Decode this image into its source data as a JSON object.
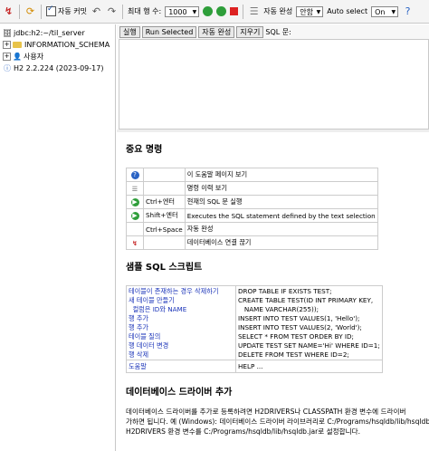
{
  "toolbar": {
    "auto_commit_label": "자동 커밋",
    "max_rows_label": "최대 행 수:",
    "max_rows_value": "1000",
    "auto_complete_label": "자동 완성",
    "auto_complete_value": "안함",
    "auto_select_label": "Auto select",
    "auto_select_value": "On"
  },
  "tree": {
    "connection": "jdbc:h2:~/til_server",
    "schema": "INFORMATION_SCHEMA",
    "users": "사용자",
    "version": "H2 2.2.224 (2023-09-17)"
  },
  "commands": {
    "run": "실행",
    "run_selected": "Run Selected",
    "auto_complete": "자동 완성",
    "clear": "지우기",
    "sql_statement": "SQL 문:"
  },
  "important": {
    "title": "중요 명령",
    "rows": [
      {
        "icon": "help-icon",
        "keys": "",
        "desc": "이 도움말 페이지 보기"
      },
      {
        "icon": "history-icon",
        "keys": "",
        "desc": "명령 이력 보기"
      },
      {
        "icon": "run-icon",
        "keys": "Ctrl+엔터",
        "desc": "현재의 SQL 문 실행"
      },
      {
        "icon": "run-selected-icon",
        "keys": "Shift+엔터",
        "desc": "Executes the SQL statement defined by the text selection"
      },
      {
        "icon": "",
        "keys": "Ctrl+Space",
        "desc": "자동 완성"
      },
      {
        "icon": "disconnect-icon",
        "keys": "",
        "desc": "데이터베이스 연결 끊기"
      }
    ]
  },
  "sample": {
    "title": "샘플 SQL 스크립트",
    "links": [
      "테이블이 존재하는 경우 삭제하기",
      "새 테이블 만들기",
      "  컬럼은 ID와 NAME",
      "행 추가",
      "행 추가",
      "테이블 질의",
      "행 데이터 변경",
      "행 삭제"
    ],
    "code": [
      "DROP TABLE IF EXISTS TEST;",
      "CREATE TABLE TEST(ID INT PRIMARY KEY,",
      "   NAME VARCHAR(255));",
      "INSERT INTO TEST VALUES(1, 'Hello');",
      "INSERT INTO TEST VALUES(2, 'World');",
      "SELECT * FROM TEST ORDER BY ID;",
      "UPDATE TEST SET NAME='Hi' WHERE ID=1;",
      "DELETE FROM TEST WHERE ID=2;"
    ],
    "help_link": "도움말",
    "help_text": "HELP ..."
  },
  "driver": {
    "title": "데이터베이스 드라이버 추가",
    "line1": "데이터베이스 드라이버를 추가로 등록하려면 H2DRIVERS나 CLASSPATH 환경 변수에 드라이버",
    "line2": "가하면 됩니다. 예 (Windows): 데이터베이스 드라이버 라이브러리로 C:/Programs/hsqldb/lib/hsqldb",
    "line3": "H2DRIVERS 환경 변수를 C:/Programs/hsqldb/lib/hsqldb.jar로 설정합니다."
  }
}
